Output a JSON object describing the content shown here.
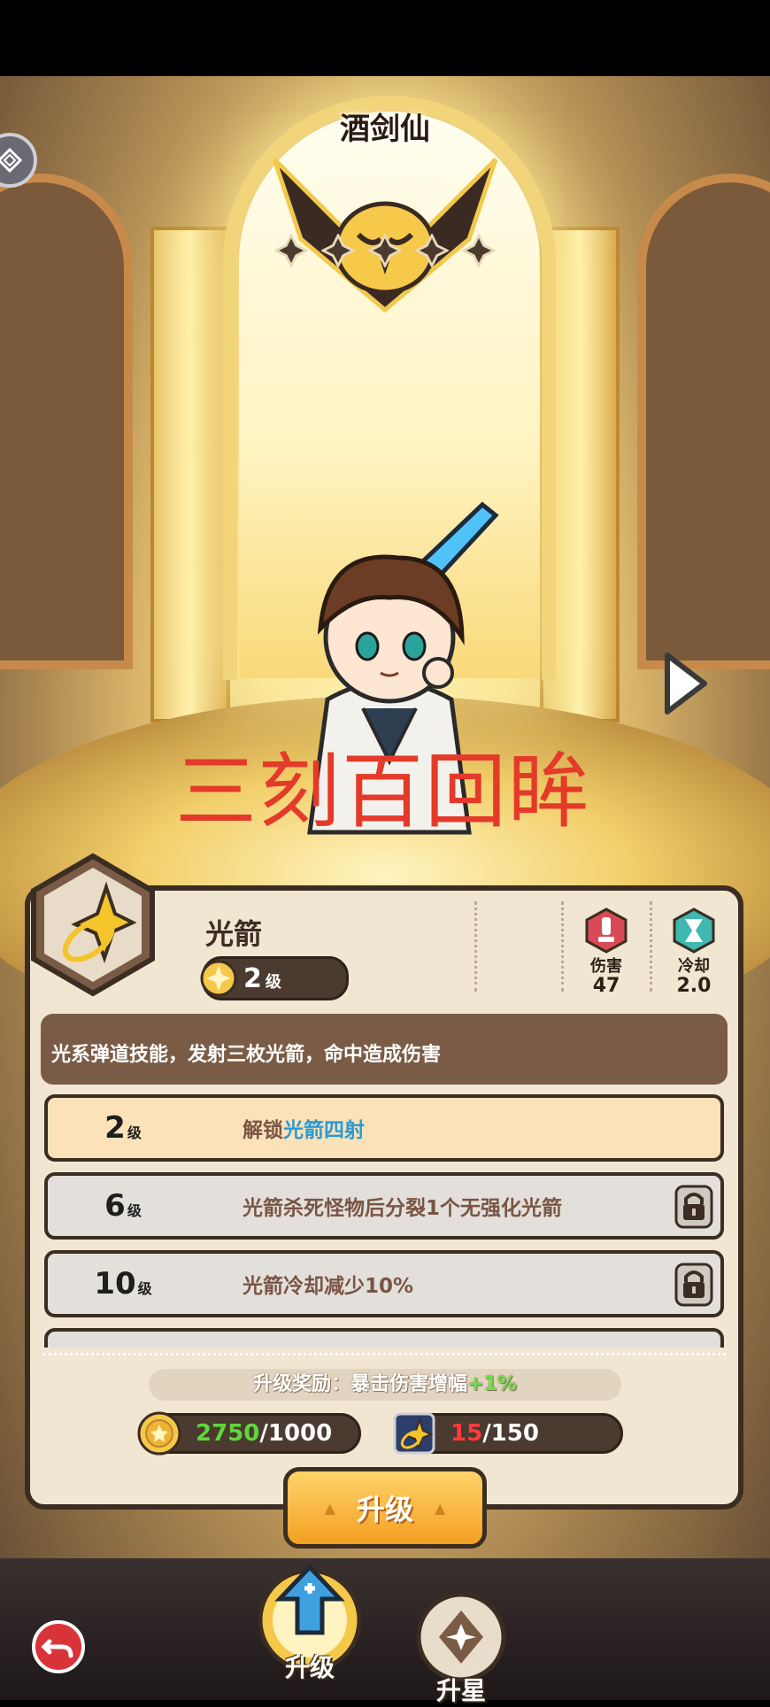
{
  "hero": {
    "name": "酒剑仙",
    "star_count": 5
  },
  "watermark": "三刻百回眸",
  "skill": {
    "name": "光箭",
    "level": "2",
    "level_unit": "级",
    "description": "光系弹道技能，发射三枚光箭，命中造成伤害"
  },
  "stats": [
    {
      "label": "伤害",
      "value": "47",
      "icon": "damage-icon",
      "color": "#d94a55"
    },
    {
      "label": "冷却",
      "value": "2.0",
      "icon": "cooldown-icon",
      "color": "#3fb8b0"
    }
  ],
  "upgrades": [
    {
      "level": "2",
      "unit": "级",
      "text_prefix": "解锁",
      "text_highlight": "光箭四射",
      "text": "",
      "locked": false
    },
    {
      "level": "6",
      "unit": "级",
      "text_prefix": "",
      "text_highlight": "",
      "text": "光箭杀死怪物后分裂1个无强化光箭",
      "locked": true
    },
    {
      "level": "10",
      "unit": "级",
      "text_prefix": "",
      "text_highlight": "",
      "text": "光箭冷却减少10%",
      "locked": true
    }
  ],
  "reward": {
    "label": "升级奖励：暴击伤害增幅",
    "bonus": "+1%"
  },
  "resources": {
    "coins": {
      "have": "2750",
      "need": "/1000"
    },
    "scrolls": {
      "have": "15",
      "need": "/150"
    }
  },
  "buttons": {
    "upgrade": "升级"
  },
  "tabs": [
    {
      "label": "升级"
    },
    {
      "label": "升星"
    }
  ],
  "colors": {
    "panel": "#f1e6d2",
    "accent": "#f4a023",
    "highlight": "#2a9ad6",
    "outline": "#3b2d22"
  }
}
